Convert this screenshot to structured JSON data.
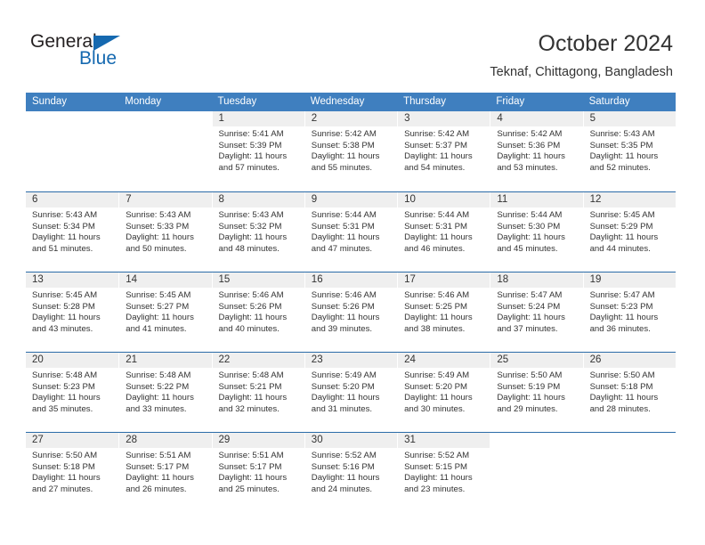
{
  "brand": {
    "name_top": "General",
    "name_bottom": "Blue",
    "accent_color": "#1569b0",
    "triangle_icon": "triangle-icon"
  },
  "header": {
    "title": "October 2024",
    "subtitle": "Teknaf, Chittagong, Bangladesh"
  },
  "theme": {
    "header_row_bg": "#3f7fbf",
    "row_separator": "#2b6ca8",
    "daynum_band_bg": "#efefef",
    "text_color": "#333333"
  },
  "calendar": {
    "month": "October",
    "year": "2024",
    "day_headers": [
      "Sunday",
      "Monday",
      "Tuesday",
      "Wednesday",
      "Thursday",
      "Friday",
      "Saturday"
    ],
    "labels": {
      "sunrise": "Sunrise:",
      "sunset": "Sunset:",
      "daylight": "Daylight:"
    },
    "weeks": [
      [
        {
          "day": "",
          "blank": true
        },
        {
          "day": "",
          "blank": true
        },
        {
          "day": "1",
          "sunrise": "Sunrise: 5:41 AM",
          "sunset": "Sunset: 5:39 PM",
          "daylight_1": "Daylight: 11 hours",
          "daylight_2": "and 57 minutes."
        },
        {
          "day": "2",
          "sunrise": "Sunrise: 5:42 AM",
          "sunset": "Sunset: 5:38 PM",
          "daylight_1": "Daylight: 11 hours",
          "daylight_2": "and 55 minutes."
        },
        {
          "day": "3",
          "sunrise": "Sunrise: 5:42 AM",
          "sunset": "Sunset: 5:37 PM",
          "daylight_1": "Daylight: 11 hours",
          "daylight_2": "and 54 minutes."
        },
        {
          "day": "4",
          "sunrise": "Sunrise: 5:42 AM",
          "sunset": "Sunset: 5:36 PM",
          "daylight_1": "Daylight: 11 hours",
          "daylight_2": "and 53 minutes."
        },
        {
          "day": "5",
          "sunrise": "Sunrise: 5:43 AM",
          "sunset": "Sunset: 5:35 PM",
          "daylight_1": "Daylight: 11 hours",
          "daylight_2": "and 52 minutes."
        }
      ],
      [
        {
          "day": "6",
          "sunrise": "Sunrise: 5:43 AM",
          "sunset": "Sunset: 5:34 PM",
          "daylight_1": "Daylight: 11 hours",
          "daylight_2": "and 51 minutes."
        },
        {
          "day": "7",
          "sunrise": "Sunrise: 5:43 AM",
          "sunset": "Sunset: 5:33 PM",
          "daylight_1": "Daylight: 11 hours",
          "daylight_2": "and 50 minutes."
        },
        {
          "day": "8",
          "sunrise": "Sunrise: 5:43 AM",
          "sunset": "Sunset: 5:32 PM",
          "daylight_1": "Daylight: 11 hours",
          "daylight_2": "and 48 minutes."
        },
        {
          "day": "9",
          "sunrise": "Sunrise: 5:44 AM",
          "sunset": "Sunset: 5:31 PM",
          "daylight_1": "Daylight: 11 hours",
          "daylight_2": "and 47 minutes."
        },
        {
          "day": "10",
          "sunrise": "Sunrise: 5:44 AM",
          "sunset": "Sunset: 5:31 PM",
          "daylight_1": "Daylight: 11 hours",
          "daylight_2": "and 46 minutes."
        },
        {
          "day": "11",
          "sunrise": "Sunrise: 5:44 AM",
          "sunset": "Sunset: 5:30 PM",
          "daylight_1": "Daylight: 11 hours",
          "daylight_2": "and 45 minutes."
        },
        {
          "day": "12",
          "sunrise": "Sunrise: 5:45 AM",
          "sunset": "Sunset: 5:29 PM",
          "daylight_1": "Daylight: 11 hours",
          "daylight_2": "and 44 minutes."
        }
      ],
      [
        {
          "day": "13",
          "sunrise": "Sunrise: 5:45 AM",
          "sunset": "Sunset: 5:28 PM",
          "daylight_1": "Daylight: 11 hours",
          "daylight_2": "and 43 minutes."
        },
        {
          "day": "14",
          "sunrise": "Sunrise: 5:45 AM",
          "sunset": "Sunset: 5:27 PM",
          "daylight_1": "Daylight: 11 hours",
          "daylight_2": "and 41 minutes."
        },
        {
          "day": "15",
          "sunrise": "Sunrise: 5:46 AM",
          "sunset": "Sunset: 5:26 PM",
          "daylight_1": "Daylight: 11 hours",
          "daylight_2": "and 40 minutes."
        },
        {
          "day": "16",
          "sunrise": "Sunrise: 5:46 AM",
          "sunset": "Sunset: 5:26 PM",
          "daylight_1": "Daylight: 11 hours",
          "daylight_2": "and 39 minutes."
        },
        {
          "day": "17",
          "sunrise": "Sunrise: 5:46 AM",
          "sunset": "Sunset: 5:25 PM",
          "daylight_1": "Daylight: 11 hours",
          "daylight_2": "and 38 minutes."
        },
        {
          "day": "18",
          "sunrise": "Sunrise: 5:47 AM",
          "sunset": "Sunset: 5:24 PM",
          "daylight_1": "Daylight: 11 hours",
          "daylight_2": "and 37 minutes."
        },
        {
          "day": "19",
          "sunrise": "Sunrise: 5:47 AM",
          "sunset": "Sunset: 5:23 PM",
          "daylight_1": "Daylight: 11 hours",
          "daylight_2": "and 36 minutes."
        }
      ],
      [
        {
          "day": "20",
          "sunrise": "Sunrise: 5:48 AM",
          "sunset": "Sunset: 5:23 PM",
          "daylight_1": "Daylight: 11 hours",
          "daylight_2": "and 35 minutes."
        },
        {
          "day": "21",
          "sunrise": "Sunrise: 5:48 AM",
          "sunset": "Sunset: 5:22 PM",
          "daylight_1": "Daylight: 11 hours",
          "daylight_2": "and 33 minutes."
        },
        {
          "day": "22",
          "sunrise": "Sunrise: 5:48 AM",
          "sunset": "Sunset: 5:21 PM",
          "daylight_1": "Daylight: 11 hours",
          "daylight_2": "and 32 minutes."
        },
        {
          "day": "23",
          "sunrise": "Sunrise: 5:49 AM",
          "sunset": "Sunset: 5:20 PM",
          "daylight_1": "Daylight: 11 hours",
          "daylight_2": "and 31 minutes."
        },
        {
          "day": "24",
          "sunrise": "Sunrise: 5:49 AM",
          "sunset": "Sunset: 5:20 PM",
          "daylight_1": "Daylight: 11 hours",
          "daylight_2": "and 30 minutes."
        },
        {
          "day": "25",
          "sunrise": "Sunrise: 5:50 AM",
          "sunset": "Sunset: 5:19 PM",
          "daylight_1": "Daylight: 11 hours",
          "daylight_2": "and 29 minutes."
        },
        {
          "day": "26",
          "sunrise": "Sunrise: 5:50 AM",
          "sunset": "Sunset: 5:18 PM",
          "daylight_1": "Daylight: 11 hours",
          "daylight_2": "and 28 minutes."
        }
      ],
      [
        {
          "day": "27",
          "sunrise": "Sunrise: 5:50 AM",
          "sunset": "Sunset: 5:18 PM",
          "daylight_1": "Daylight: 11 hours",
          "daylight_2": "and 27 minutes."
        },
        {
          "day": "28",
          "sunrise": "Sunrise: 5:51 AM",
          "sunset": "Sunset: 5:17 PM",
          "daylight_1": "Daylight: 11 hours",
          "daylight_2": "and 26 minutes."
        },
        {
          "day": "29",
          "sunrise": "Sunrise: 5:51 AM",
          "sunset": "Sunset: 5:17 PM",
          "daylight_1": "Daylight: 11 hours",
          "daylight_2": "and 25 minutes."
        },
        {
          "day": "30",
          "sunrise": "Sunrise: 5:52 AM",
          "sunset": "Sunset: 5:16 PM",
          "daylight_1": "Daylight: 11 hours",
          "daylight_2": "and 24 minutes."
        },
        {
          "day": "31",
          "sunrise": "Sunrise: 5:52 AM",
          "sunset": "Sunset: 5:15 PM",
          "daylight_1": "Daylight: 11 hours",
          "daylight_2": "and 23 minutes."
        },
        {
          "day": "",
          "blank": true
        },
        {
          "day": "",
          "blank": true
        }
      ]
    ]
  }
}
